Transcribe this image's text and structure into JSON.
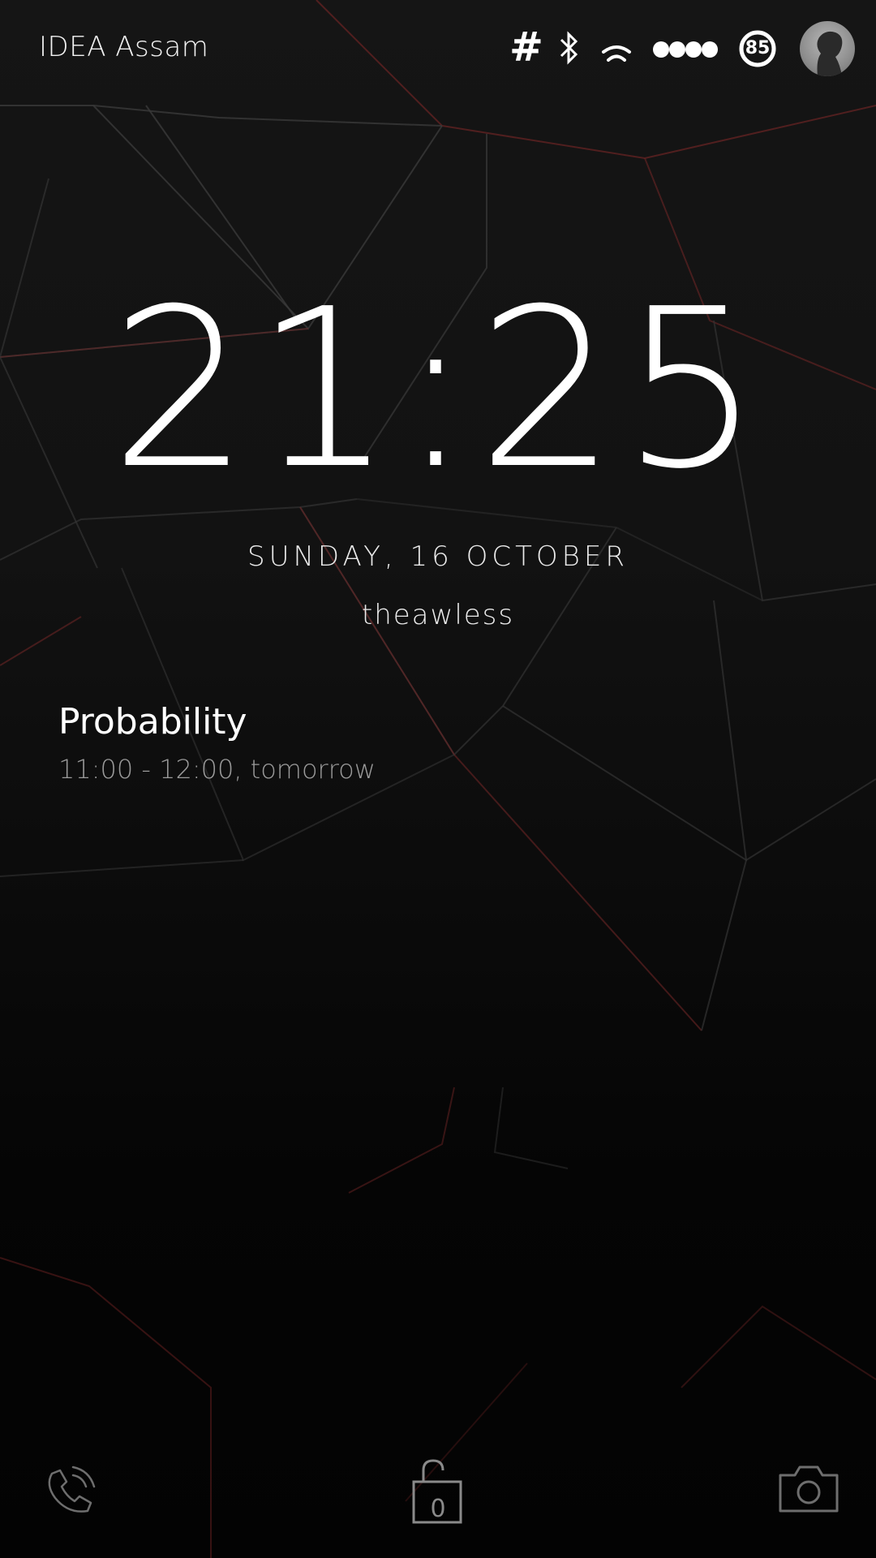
{
  "status_bar": {
    "carrier": "IDEA Assam",
    "hash_symbol": "#",
    "battery_percent": "85",
    "icons": [
      "hash-icon",
      "bluetooth-icon",
      "wifi-icon",
      "signal-icon",
      "battery-icon",
      "avatar"
    ]
  },
  "lockscreen": {
    "time": "21:25",
    "date": "SUNDAY, 16 OCTOBER",
    "owner": "theawless"
  },
  "event": {
    "title": "Probability",
    "time": "11:00 - 12:00, tomorrow"
  },
  "shortcuts": {
    "unlock_count": "0",
    "icons": [
      "phone-icon",
      "unlock-icon",
      "camera-icon"
    ]
  },
  "colors": {
    "background": "#121212",
    "text": "#ffffff",
    "secondary_text": "#9a9a9a",
    "accent_lines": "#7a2020"
  }
}
